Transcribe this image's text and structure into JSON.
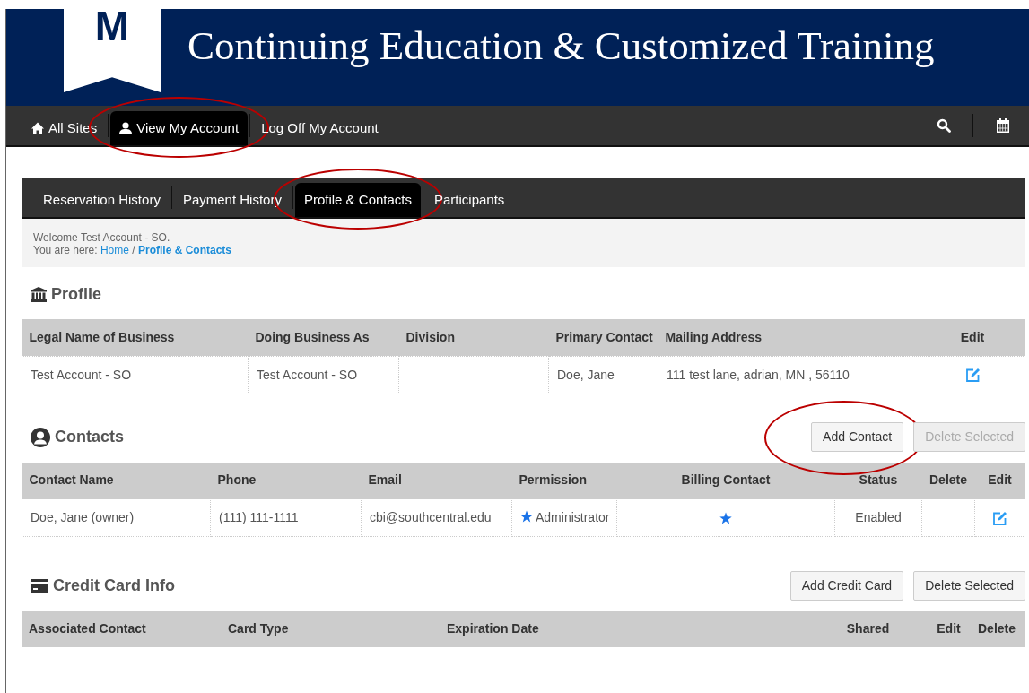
{
  "header": {
    "logo_letter": "M",
    "title": "Continuing Education & Customized Training"
  },
  "top_nav": [
    {
      "label": "All Sites",
      "selected": false,
      "circled": false
    },
    {
      "label": "View My Account",
      "selected": true,
      "circled": true
    },
    {
      "label": "Log Off My Account",
      "selected": false,
      "circled": false
    }
  ],
  "tabs": [
    {
      "label": "Reservation History",
      "selected": false,
      "circled": false
    },
    {
      "label": "Payment History",
      "selected": false,
      "circled": false
    },
    {
      "label": "Profile & Contacts",
      "selected": true,
      "circled": true
    },
    {
      "label": "Participants",
      "selected": false,
      "circled": false
    }
  ],
  "breadcrumb": {
    "welcome": "Welcome Test Account - SO.",
    "prefix": "You are here:",
    "links": [
      "Home",
      "Profile & Contacts"
    ],
    "separator": "/"
  },
  "sections": [
    {
      "title": "Profile",
      "columns": [
        "Legal Name of Business",
        "Doing Business As",
        "Division",
        "Primary Contact",
        "Mailing Address",
        "Edit"
      ],
      "rows": [
        [
          {
            "kind": "text",
            "text": "Test Account - SO"
          },
          {
            "kind": "text",
            "text": "Test Account - SO"
          },
          {
            "kind": "empty"
          },
          {
            "kind": "text",
            "text": "Doe, Jane"
          },
          {
            "kind": "text",
            "text": "111 test lane, adrian, MN , 56110"
          },
          {
            "kind": "edit"
          }
        ]
      ]
    },
    {
      "title": "Contacts",
      "buttons": [
        {
          "label": "Add Contact",
          "disabled": false,
          "circled": true
        },
        {
          "label": "Delete Selected",
          "disabled": true,
          "circled": false
        }
      ],
      "columns": [
        "Contact Name",
        "Phone",
        "Email",
        "Permission",
        "Billing Contact",
        "Status",
        "Delete",
        "Edit"
      ],
      "rows": [
        [
          {
            "kind": "text",
            "text": "Doe, Jane (owner)"
          },
          {
            "kind": "text",
            "text": "(111) 111-1111"
          },
          {
            "kind": "text",
            "text": "cbi@southcentral.edu"
          },
          {
            "kind": "star-text",
            "text": "Administrator"
          },
          {
            "kind": "star"
          },
          {
            "kind": "text",
            "text": "Enabled"
          },
          {
            "kind": "empty"
          },
          {
            "kind": "edit"
          }
        ]
      ]
    },
    {
      "title": "Credit Card Info",
      "buttons": [
        {
          "label": "Add Credit Card",
          "disabled": false,
          "circled": false
        },
        {
          "label": "Delete Selected",
          "disabled": false,
          "circled": false
        }
      ],
      "columns": [
        "Associated Contact",
        "Card Type",
        "Expiration Date",
        "Shared",
        "Edit",
        "Delete"
      ]
    }
  ]
}
